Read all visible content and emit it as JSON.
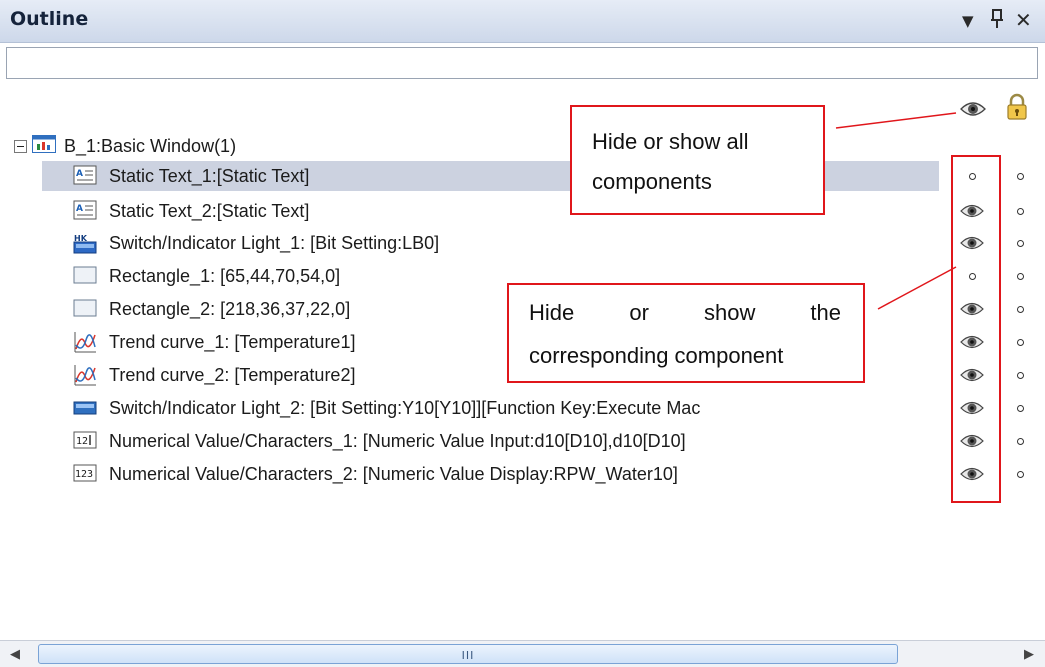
{
  "panel": {
    "title": "Outline",
    "dropdown_glyph": "▼",
    "pin_glyph": "ᛘ",
    "close_glyph": "✕"
  },
  "search": {
    "value": ""
  },
  "header_icons": {
    "visibility": "eye-icon",
    "lock": "lock-icon"
  },
  "tree": {
    "root": {
      "label": "B_1:Basic Window(1)",
      "icon": "window-icon"
    },
    "items": [
      {
        "label": "Static Text_1:[Static Text]",
        "icon": "static-text-icon",
        "visible": false,
        "selected": true
      },
      {
        "label": "Static Text_2:[Static Text]",
        "icon": "static-text-icon",
        "visible": true
      },
      {
        "label": "Switch/Indicator Light_1: [Bit Setting:LB0]",
        "icon": "switch-icon",
        "visible": true
      },
      {
        "label": "Rectangle_1: [65,44,70,54,0]",
        "icon": "rectangle-icon",
        "visible": false
      },
      {
        "label": "Rectangle_2: [218,36,37,22,0]",
        "icon": "rectangle-icon",
        "visible": true
      },
      {
        "label": "Trend curve_1: [Temperature1]",
        "icon": "trend-curve-icon",
        "visible": true
      },
      {
        "label": "Trend curve_2: [Temperature2]",
        "icon": "trend-curve-icon",
        "visible": true
      },
      {
        "label": "Switch/Indicator Light_2: [Bit Setting:Y10[Y10]][Function Key:Execute Mac",
        "icon": "indicator-light-icon",
        "visible": true
      },
      {
        "label": "Numerical Value/Characters_1: [Numeric Value Input:d10[D10],d10[D10]",
        "icon": "numeric-input-icon",
        "visible": true
      },
      {
        "label": "Numerical Value/Characters_2: [Numeric Value Display:RPW_Water10]",
        "icon": "numeric-display-icon",
        "visible": true
      }
    ]
  },
  "annotations": {
    "all_components": [
      "Hide or show all",
      "components"
    ],
    "corresponding_component": [
      "Hide",
      "or",
      "show",
      "the",
      "corresponding component"
    ]
  },
  "scrollbar": {
    "left_glyph": "◀",
    "right_glyph": "▶",
    "grip": "III"
  },
  "colors": {
    "annotation_red": "#e0161b",
    "selection_bg": "#ccd2e0",
    "titlebar": "#dbe3f0"
  }
}
